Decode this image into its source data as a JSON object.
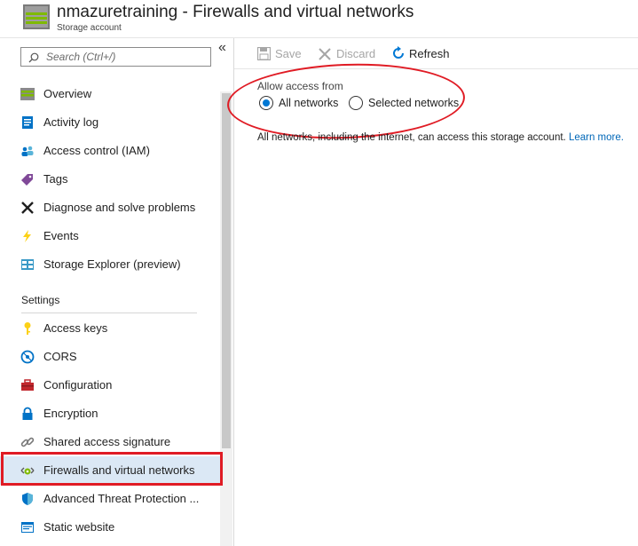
{
  "header": {
    "title": "nmazuretraining - Firewalls and virtual networks",
    "subtitle": "Storage account"
  },
  "sidebar": {
    "search_placeholder": "Search (Ctrl+/)",
    "collapse_glyph": "«",
    "items": [
      {
        "label": "Overview",
        "icon": "overview-icon"
      },
      {
        "label": "Activity log",
        "icon": "activity-log-icon"
      },
      {
        "label": "Access control (IAM)",
        "icon": "iam-icon"
      },
      {
        "label": "Tags",
        "icon": "tag-icon"
      },
      {
        "label": "Diagnose and solve problems",
        "icon": "wrench-icon"
      },
      {
        "label": "Events",
        "icon": "lightning-icon"
      },
      {
        "label": "Storage Explorer (preview)",
        "icon": "storage-explorer-icon"
      }
    ],
    "settings_section": {
      "label": "Settings",
      "items": [
        {
          "label": "Access keys",
          "icon": "key-icon"
        },
        {
          "label": "CORS",
          "icon": "cors-icon"
        },
        {
          "label": "Configuration",
          "icon": "toolbox-icon"
        },
        {
          "label": "Encryption",
          "icon": "lock-icon"
        },
        {
          "label": "Shared access signature",
          "icon": "link-icon"
        },
        {
          "label": "Firewalls and virtual networks",
          "icon": "firewall-icon",
          "selected": true
        },
        {
          "label": "Advanced Threat Protection ...",
          "icon": "shield-icon"
        },
        {
          "label": "Static website",
          "icon": "static-website-icon"
        }
      ]
    }
  },
  "toolbar": {
    "save_label": "Save",
    "discard_label": "Discard",
    "refresh_label": "Refresh"
  },
  "content": {
    "allow_access_label": "Allow access from",
    "options": [
      {
        "label": "All networks",
        "checked": true
      },
      {
        "label": "Selected networks",
        "checked": false
      }
    ],
    "description": "All networks, including the internet, can access this storage account.",
    "learn_more": "Learn more."
  },
  "colors": {
    "accent": "#0078d4",
    "link": "#0067b8",
    "annotation_red": "#e01b24",
    "selected_bg": "#dbe8f5"
  }
}
